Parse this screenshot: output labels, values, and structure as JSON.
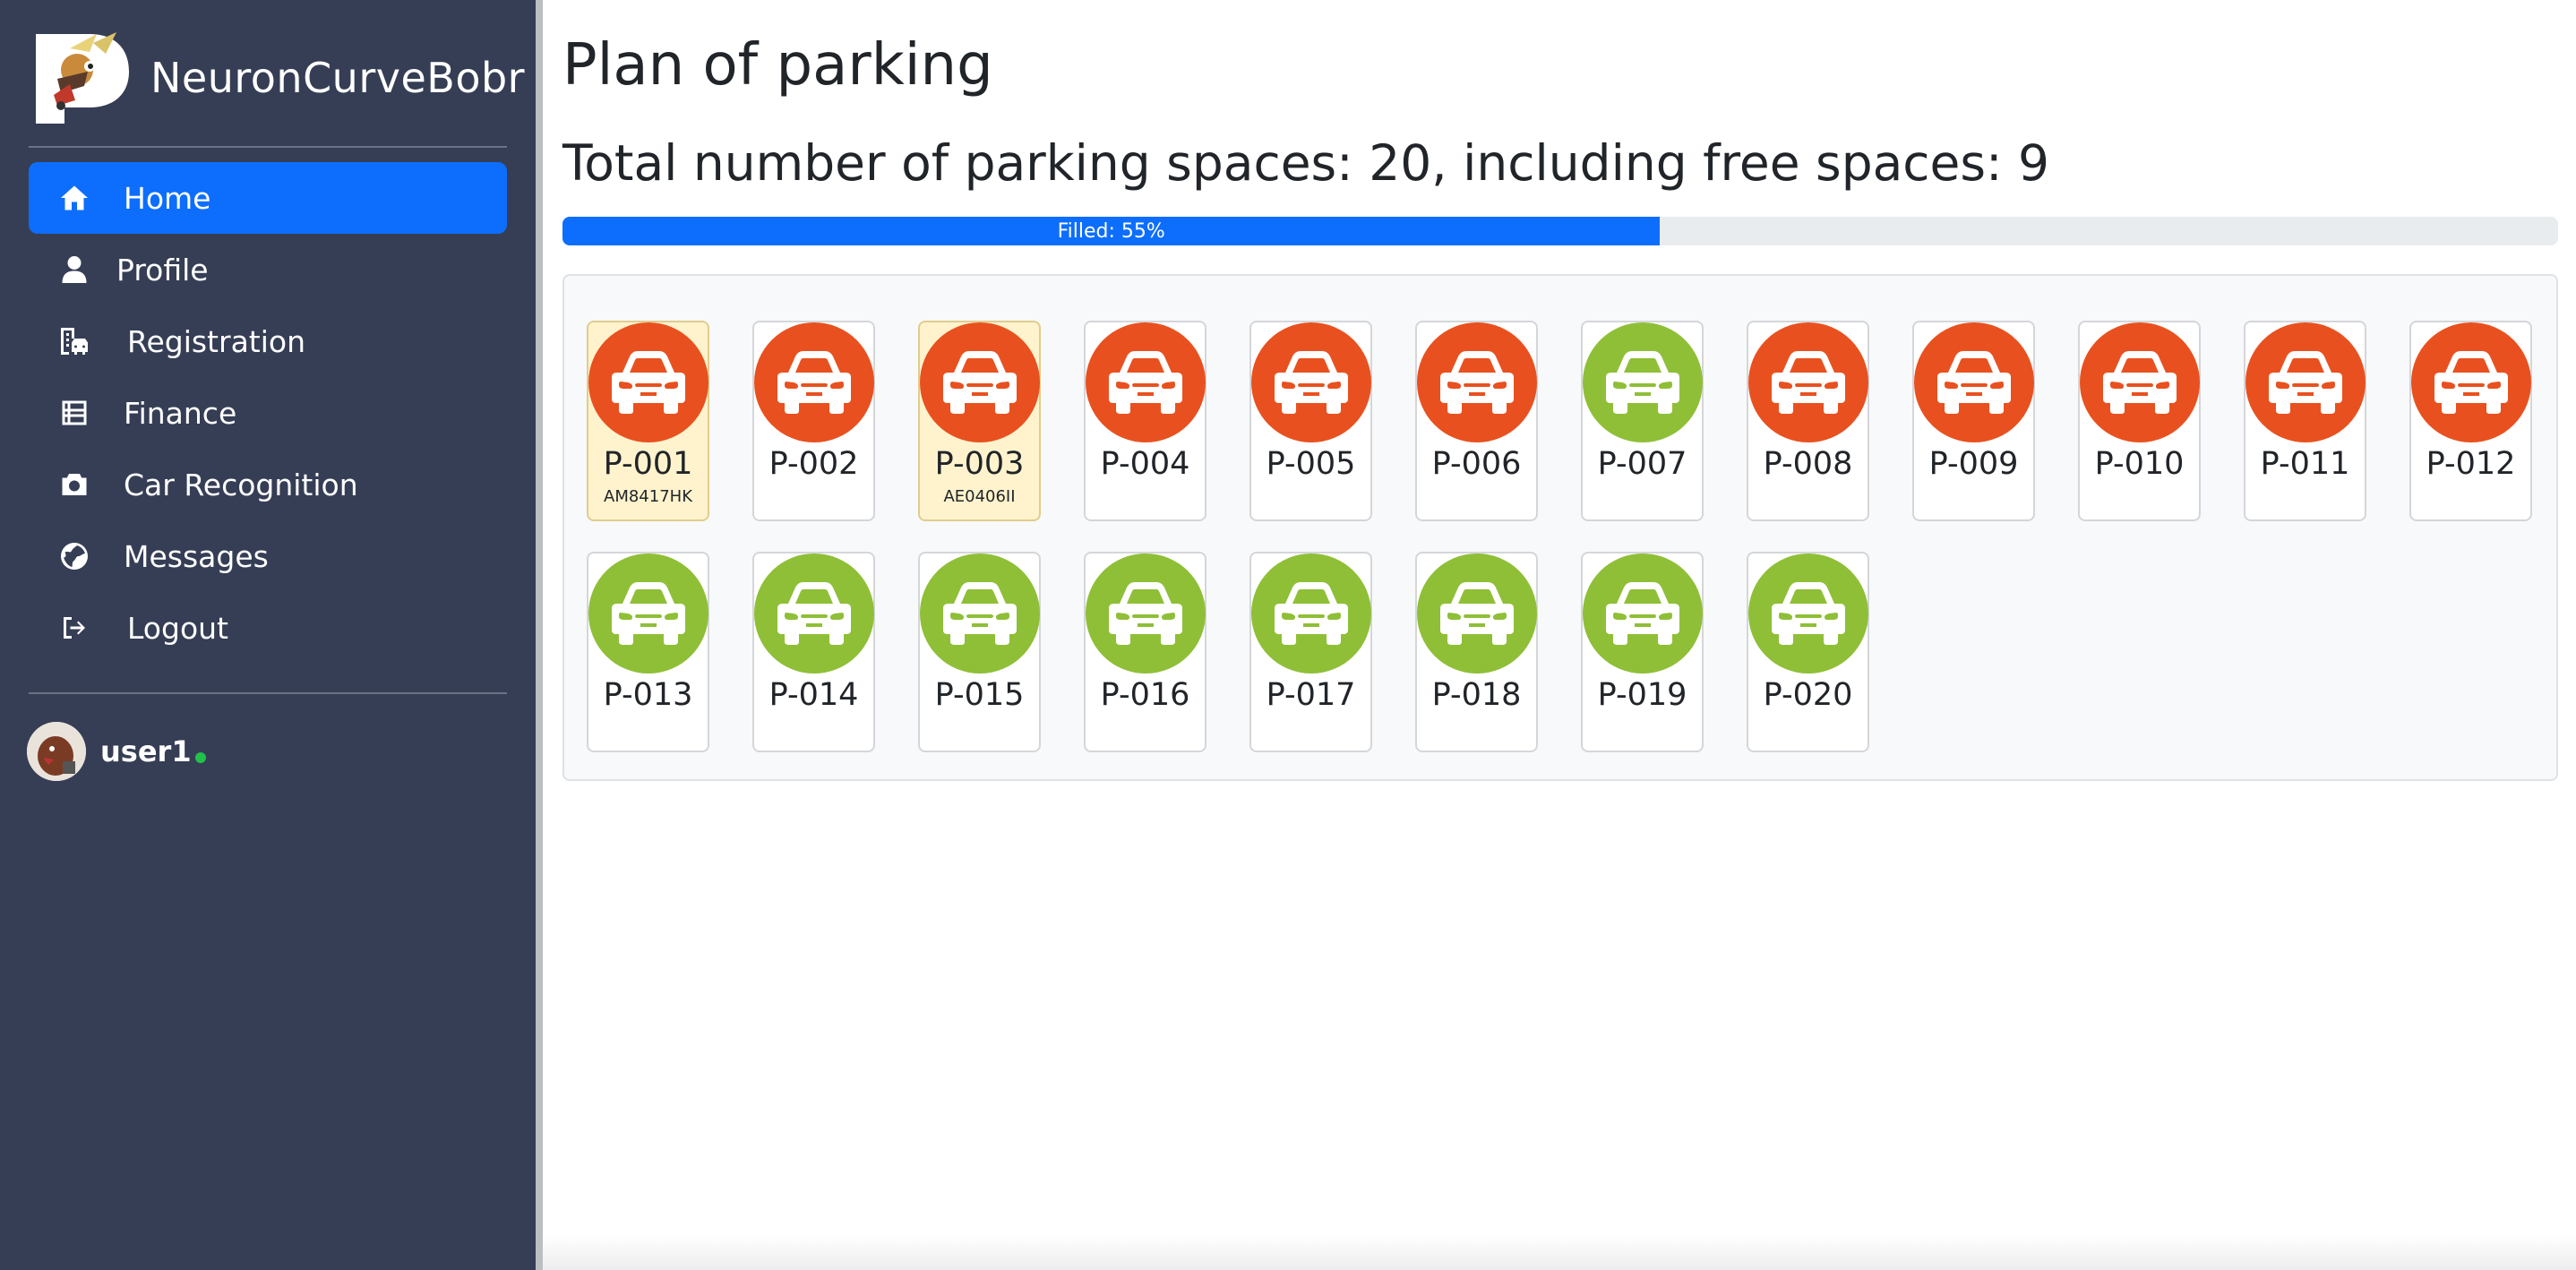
{
  "sidebar": {
    "brand": "NeuronCurveBobr",
    "items": [
      {
        "label": "Home",
        "icon": "home-icon",
        "active": true
      },
      {
        "label": "Profile",
        "icon": "user-icon",
        "active": false
      },
      {
        "label": "Registration",
        "icon": "building-car-icon",
        "active": false
      },
      {
        "label": "Finance",
        "icon": "table-list-icon",
        "active": false
      },
      {
        "label": "Car Recognition",
        "icon": "camera-icon",
        "active": false
      },
      {
        "label": "Messages",
        "icon": "globe-icon",
        "active": false
      },
      {
        "label": "Logout",
        "icon": "logout-icon",
        "active": false
      }
    ],
    "user": {
      "name": "user1",
      "status": "online"
    }
  },
  "main": {
    "title": "Plan of parking",
    "summary": "Total number of parking spaces: 20, including free spaces: 9",
    "progress": {
      "label": "Filled: 55%",
      "percent": 55
    }
  },
  "colors": {
    "sidebar_bg": "#363e55",
    "accent": "#0d6efd",
    "busy": "#e8511f",
    "free": "#8fbf37",
    "reserved_bg": "#fff3cd"
  },
  "spots": [
    {
      "id": "P-001",
      "status": "busy",
      "reserved": true,
      "plate": "AM8417HK"
    },
    {
      "id": "P-002",
      "status": "busy",
      "reserved": false,
      "plate": ""
    },
    {
      "id": "P-003",
      "status": "busy",
      "reserved": true,
      "plate": "AE0406II"
    },
    {
      "id": "P-004",
      "status": "busy",
      "reserved": false,
      "plate": ""
    },
    {
      "id": "P-005",
      "status": "busy",
      "reserved": false,
      "plate": ""
    },
    {
      "id": "P-006",
      "status": "busy",
      "reserved": false,
      "plate": ""
    },
    {
      "id": "P-007",
      "status": "free",
      "reserved": false,
      "plate": ""
    },
    {
      "id": "P-008",
      "status": "busy",
      "reserved": false,
      "plate": ""
    },
    {
      "id": "P-009",
      "status": "busy",
      "reserved": false,
      "plate": ""
    },
    {
      "id": "P-010",
      "status": "busy",
      "reserved": false,
      "plate": ""
    },
    {
      "id": "P-011",
      "status": "busy",
      "reserved": false,
      "plate": ""
    },
    {
      "id": "P-012",
      "status": "busy",
      "reserved": false,
      "plate": ""
    },
    {
      "id": "P-013",
      "status": "free",
      "reserved": false,
      "plate": ""
    },
    {
      "id": "P-014",
      "status": "free",
      "reserved": false,
      "plate": ""
    },
    {
      "id": "P-015",
      "status": "free",
      "reserved": false,
      "plate": ""
    },
    {
      "id": "P-016",
      "status": "free",
      "reserved": false,
      "plate": ""
    },
    {
      "id": "P-017",
      "status": "free",
      "reserved": false,
      "plate": ""
    },
    {
      "id": "P-018",
      "status": "free",
      "reserved": false,
      "plate": ""
    },
    {
      "id": "P-019",
      "status": "free",
      "reserved": false,
      "plate": ""
    },
    {
      "id": "P-020",
      "status": "free",
      "reserved": false,
      "plate": ""
    }
  ]
}
